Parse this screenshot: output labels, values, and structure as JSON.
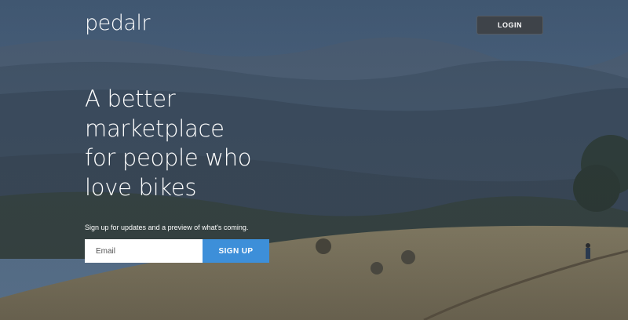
{
  "brand": {
    "logo_text": "pedalr"
  },
  "header": {
    "login_label": "LOGIN"
  },
  "hero": {
    "headline_lines": [
      "A better",
      "marketplace",
      "for people who",
      "love bikes"
    ],
    "signup_text": "Sign up for updates and a preview of what's coming.",
    "email_placeholder": "Email",
    "signup_label": "SIGN UP"
  },
  "colors": {
    "accent": "#3d8fd9",
    "login_bg": "#3e4349",
    "text": "#ffffff"
  }
}
